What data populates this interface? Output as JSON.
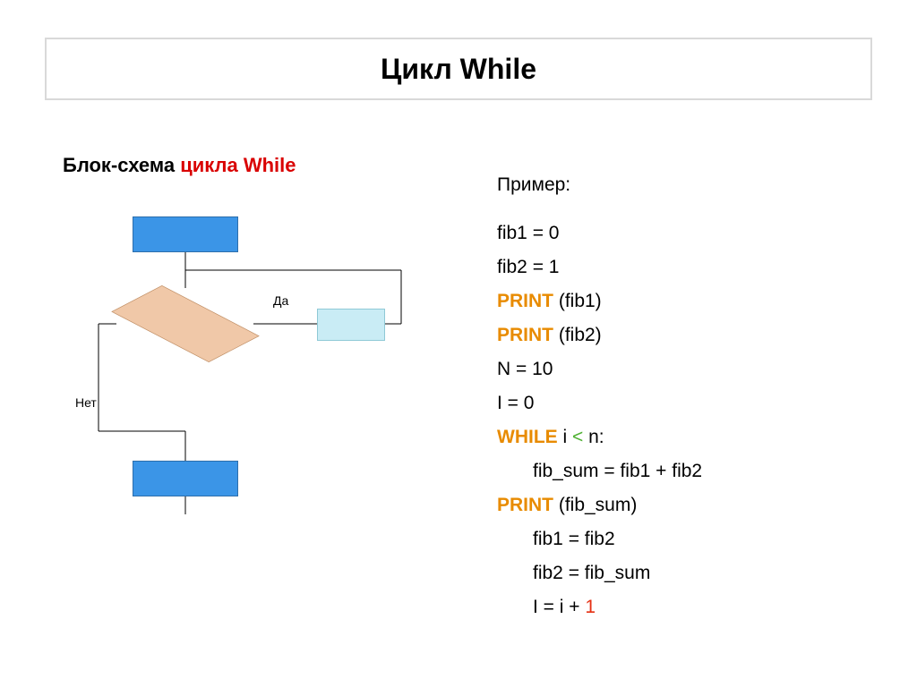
{
  "title": "Цикл While",
  "subtitle_prefix": "Блок-схема ",
  "subtitle_colored": "цикла While",
  "flowchart": {
    "label_yes": "Да",
    "label_no": "Нет"
  },
  "code": {
    "header": "Пример:",
    "lines": {
      "l1": "fib1 = 0",
      "l2": "fib2 = 1",
      "l3_kw": "Print",
      "l3_rest": " (fib1)",
      "l4_kw": "Print",
      "l4_rest": " (fib2)",
      "l5": "N = 10",
      "l6": "I = 0",
      "l7_kw": "While",
      "l7_mid": " i ",
      "l7_op": "<",
      "l7_end": " n:",
      "l8": "fib_sum = fib1 + fib2",
      "l9_kw": "Print",
      "l9_rest": " (fib_sum)",
      "l10": "fib1 = fib2",
      "l11": "fib2 = fib_sum",
      "l12_a": "I = i + ",
      "l12_b": "1"
    }
  }
}
